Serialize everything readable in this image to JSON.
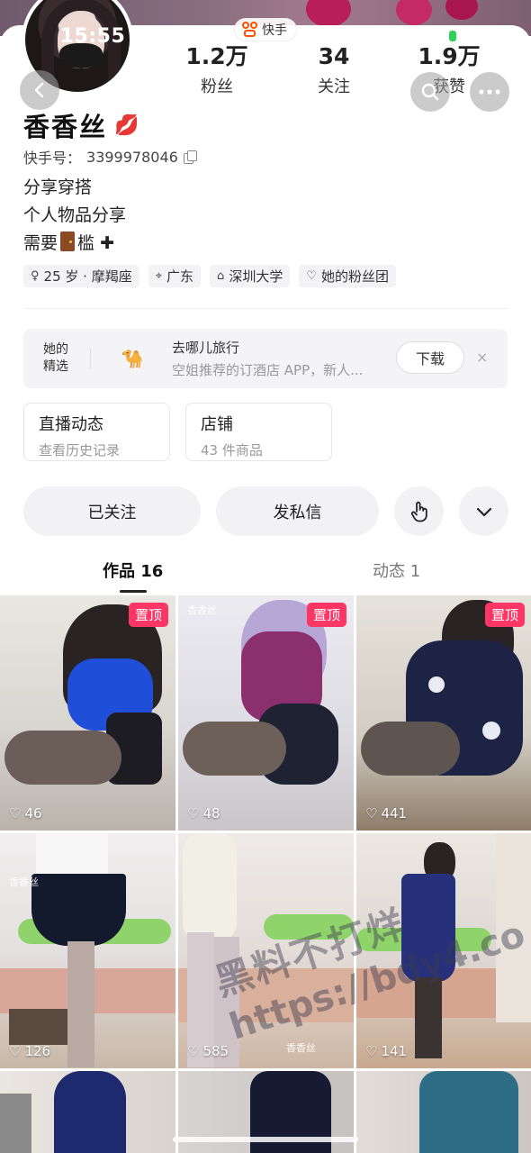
{
  "status": {
    "time": "15:55",
    "app_name": "快手"
  },
  "profile": {
    "name": "香香丝",
    "kuaishou_id_label": "快手号：",
    "kuaishou_id": "3399978046",
    "bio_lines": [
      "分享穿搭",
      "个人物品分享",
      "需要",
      "槛"
    ],
    "tags": [
      "25 岁 · 摩羯座",
      "广东",
      "深圳大学",
      "她的粉丝团"
    ]
  },
  "stats": {
    "fans": {
      "value": "1.2万",
      "label": "粉丝"
    },
    "following": {
      "value": "34",
      "label": "关注"
    },
    "likes": {
      "value": "1.9万",
      "label": "获赞"
    }
  },
  "ad": {
    "tagline_1": "她的",
    "tagline_2": "精选",
    "title": "去哪儿旅行",
    "desc": "空姐推荐的订酒店 APP，新人...",
    "download": "下载",
    "close": "×"
  },
  "shortcuts": {
    "live": {
      "title": "直播动态",
      "sub": "查看历史记录"
    },
    "shop": {
      "title": "店铺",
      "sub": "43 件商品"
    }
  },
  "actions": {
    "followed": "已关注",
    "message": "发私信"
  },
  "tabs": {
    "works": "作品 16",
    "dynamics": "动态 1"
  },
  "grid": {
    "pin_label": "置顶",
    "watermark_name": "香香丝",
    "items": [
      {
        "likes": "46",
        "pinned": true
      },
      {
        "likes": "48",
        "pinned": true
      },
      {
        "likes": "441",
        "pinned": true
      },
      {
        "likes": "126",
        "pinned": false
      },
      {
        "likes": "585",
        "pinned": false
      },
      {
        "likes": "141",
        "pinned": false
      }
    ]
  },
  "watermark": {
    "line1": "黑料不打烊",
    "line2": "https://bdy4.co"
  },
  "colors": {
    "accent": "#fe3666",
    "kuaishou_orange": "#ff5000"
  }
}
